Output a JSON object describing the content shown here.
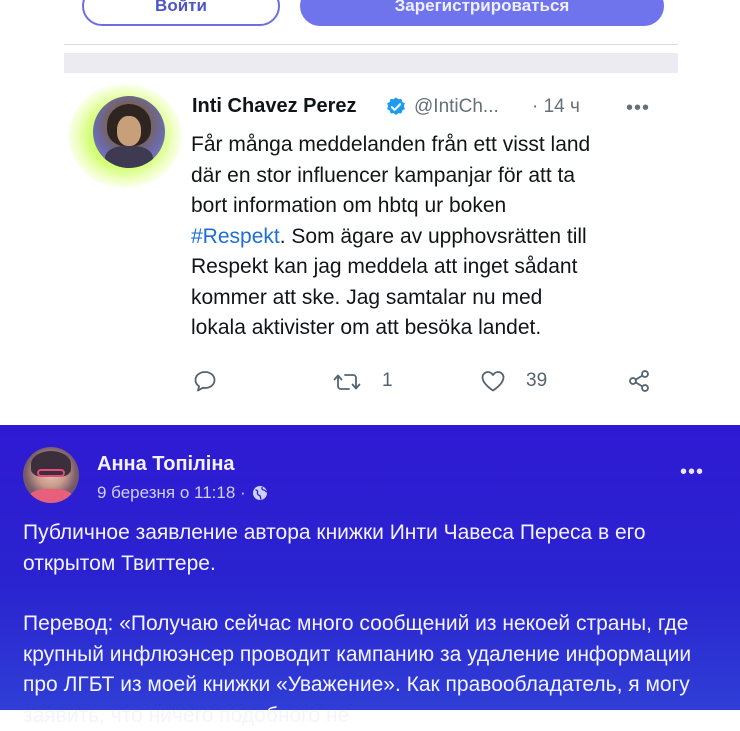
{
  "top_buttons": {
    "login_label": "Войти",
    "signup_label": "Зарегистрироваться"
  },
  "tweet": {
    "author_name": "Inti Chavez Perez",
    "handle": "@IntiCh...",
    "time": "· 14 ч",
    "text_lines": [
      "Får många meddelanden från ett visst land",
      "där en stor influencer kampanjar för att ta",
      "bort information om hbtq ur boken"
    ],
    "hashtag": "#Respekt",
    "text_after_hashtag": ". Som ägare av upphovsrätten till",
    "text_lines_end": [
      "Respekt kan jag meddela att inget sådant",
      "kommer att ske. Jag samtalar nu med",
      "lokala aktivister om att besöka landet."
    ],
    "retweet_count": "1",
    "like_count": "39",
    "icons": {
      "reply": "reply-icon",
      "retweet": "retweet-icon",
      "like": "heart-icon",
      "share": "share-icon",
      "verified": "verified-badge-icon",
      "more": "more-dots-icon"
    }
  },
  "fb_post": {
    "author_name": "Анна Топіліна",
    "date": "9 березня о 11:18 ·",
    "paragraph_1": "Публичное заявление автора книжки Инти Чавеса Переса в его открытом Твиттере.",
    "paragraph_2": "Перевод: «Получаю сейчас много сообщений из некоей страны, где крупный инфлюэнсер проводит кампанию за удаление информации про ЛГБТ из моей книжки «Уважение». Как правообладатель, я могу заявить, что ничего подобного не",
    "icons": {
      "privacy": "globe-icon",
      "more": "more-dots-icon"
    }
  },
  "colors": {
    "brand_purple": "#6f74ec",
    "hashtag_blue": "#1d6fd6",
    "fb_background": "#2f1ad3",
    "verified_blue": "#1d9bf0"
  }
}
